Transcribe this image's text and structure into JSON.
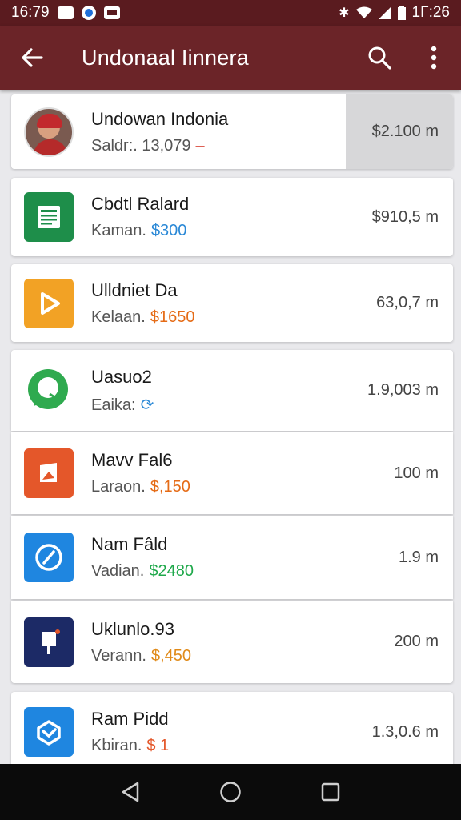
{
  "status_bar": {
    "time": "16:79",
    "time_right": "1Γ:26"
  },
  "app_bar": {
    "title": "Undonaal Iinnera"
  },
  "items": [
    {
      "name": "Undowan Indonia",
      "sub_label": "Saldr:. 13,079",
      "highlight": "–",
      "highlight_color": "#d94a3b",
      "amount": "$2.100 m",
      "icon": "profile-avatar",
      "icon_color": "#b52a2a"
    },
    {
      "name": "Cbdtl Ralard",
      "sub_label": "Kaman.",
      "highlight": "$300",
      "highlight_color": "#2a88d6",
      "amount": "$910,5 m",
      "icon": "sheets-icon",
      "icon_color": "#1e8e4a"
    },
    {
      "name": "Ulldniet Da",
      "sub_label": "Kelaan.",
      "highlight": "$1650",
      "highlight_color": "#e56b16",
      "amount": "63,0,7 m",
      "icon": "play-icon",
      "icon_color": "#f2a225"
    },
    {
      "name": "Uasuo2",
      "sub_label": "Eaika:",
      "highlight": "⟳",
      "highlight_color": "#2a88d6",
      "amount": "1.9,003 m",
      "icon": "chat-bubble-icon",
      "icon_color": "#2faa4f"
    },
    {
      "name": "Mavv Fal6",
      "sub_label": "Laraon.",
      "highlight": "$,150",
      "highlight_color": "#e56b16",
      "amount": "100 m",
      "icon": "photo-icon",
      "icon_color": "#e4572a"
    },
    {
      "name": "Nam Fâld",
      "sub_label": "Vadian.",
      "highlight": "$2480",
      "highlight_color": "#1ea84a",
      "amount": "1.9 m",
      "icon": "compass-icon",
      "icon_color": "#1f86e0"
    },
    {
      "name": "Uklunlo.93",
      "sub_label": "Verann.",
      "highlight": "$,450",
      "highlight_color": "#e08a18",
      "amount": "200 m",
      "icon": "flag-icon",
      "icon_color": "#1c2a66"
    },
    {
      "name": "Ram Pidd",
      "sub_label": "Kbiran.",
      "highlight": "$ 1",
      "highlight_color": "#e4572a",
      "amount": "1.3,0.6 m",
      "icon": "box-icon",
      "icon_color": "#1f86e0"
    }
  ]
}
